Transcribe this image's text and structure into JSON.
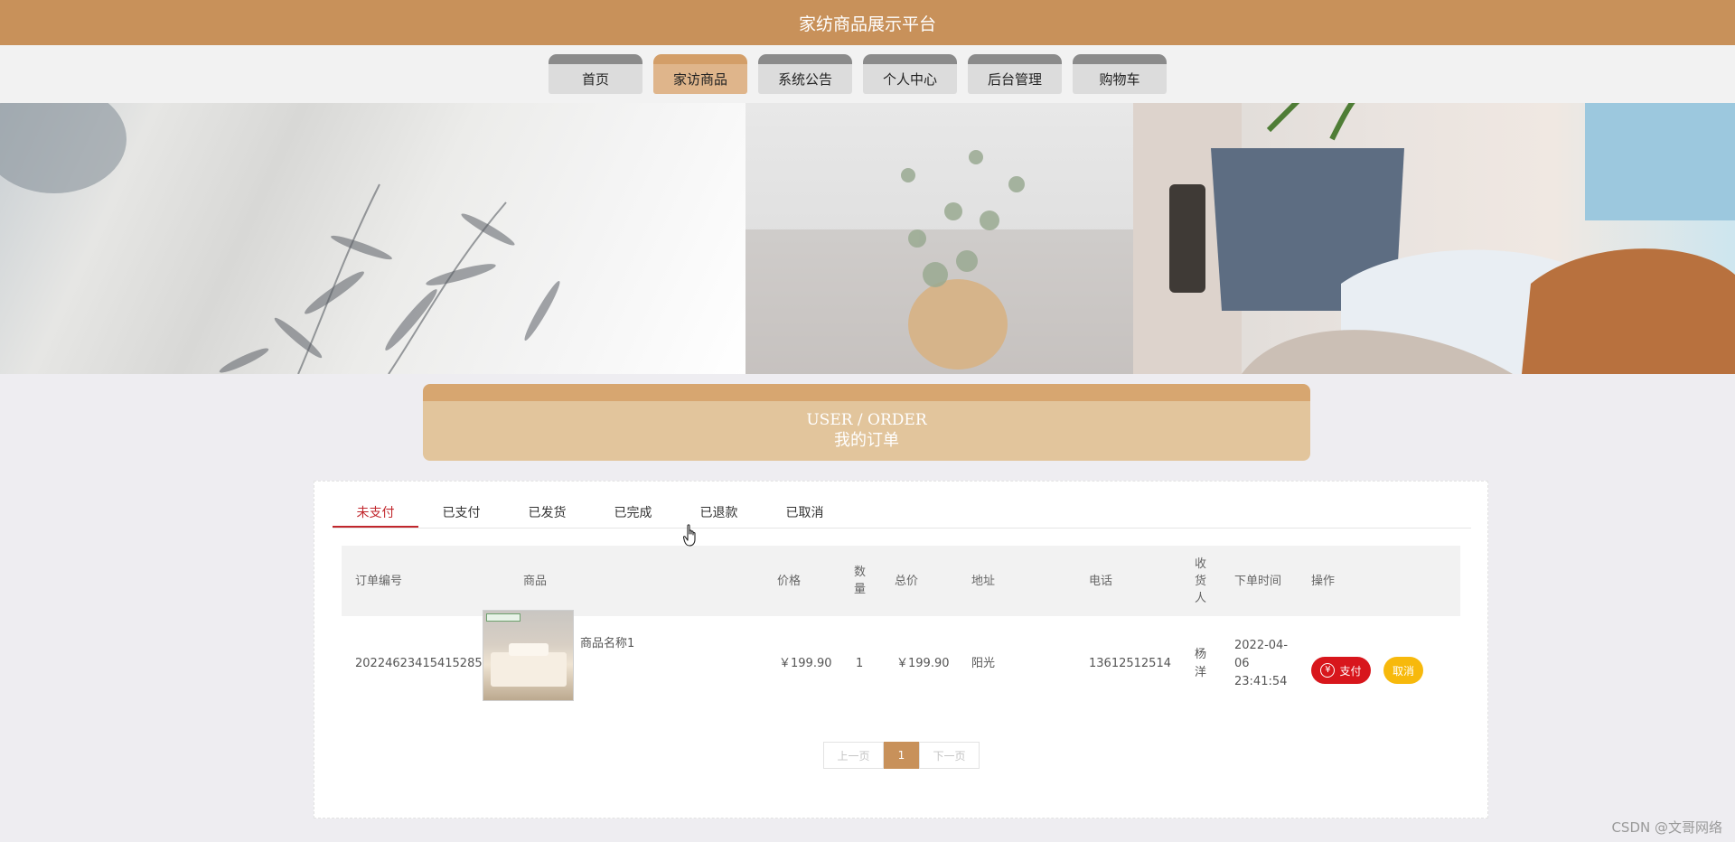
{
  "header": {
    "title": "家纺商品展示平台"
  },
  "nav": {
    "items": [
      {
        "label": "首页"
      },
      {
        "label": "家访商品"
      },
      {
        "label": "系统公告"
      },
      {
        "label": "个人中心"
      },
      {
        "label": "后台管理"
      },
      {
        "label": "购物车"
      }
    ],
    "active": "家访商品"
  },
  "section": {
    "title_en": "USER / ORDER",
    "title_cn": "我的订单"
  },
  "tabs": {
    "items": [
      {
        "label": "未支付"
      },
      {
        "label": "已支付"
      },
      {
        "label": "已发货"
      },
      {
        "label": "已完成"
      },
      {
        "label": "已退款"
      },
      {
        "label": "已取消"
      }
    ],
    "active": "未支付"
  },
  "table": {
    "columns": {
      "order_no": "订单编号",
      "product": "商品",
      "price": "价格",
      "qty": "数量",
      "total": "总价",
      "address": "地址",
      "phone": "电话",
      "receiver": "收货人",
      "time": "下单时间",
      "actions": "操作"
    },
    "rows": [
      {
        "order_no": "20224623415415285837",
        "product_name": "商品名称1",
        "price": "￥199.90",
        "qty": "1",
        "total": "￥199.90",
        "address": "阳光",
        "phone": "13612512514",
        "receiver": "杨洋",
        "time": "2022-04-06 23:41:54",
        "pay_label": "支付",
        "cancel_label": "取消"
      }
    ]
  },
  "pagination": {
    "prev": "上一页",
    "current": "1",
    "next": "下一页"
  },
  "watermark": "CSDN @文哥网络",
  "colors": {
    "brand": "#c8915a",
    "nav_active": "#dfb58b",
    "tab_active": "#c1272d",
    "pay": "#d8161c",
    "cancel": "#f7b90c"
  }
}
